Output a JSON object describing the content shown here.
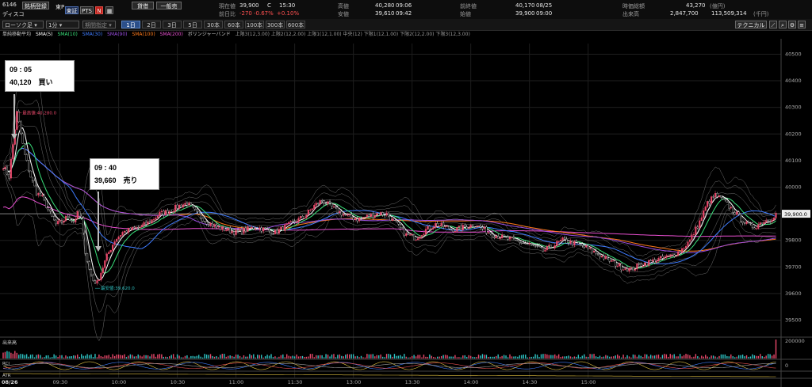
{
  "header": {
    "code": "6146",
    "name": "ディスコ",
    "btn_register": "銘柄登録",
    "tag_market": "東P",
    "btn_tosho": "東証",
    "btn_pts": "PTS",
    "btn_n": "N",
    "btn_buy": "貸借",
    "btn_general": "一般売",
    "current_label": "現在値",
    "current_value": "39,900",
    "current_flag": "C",
    "current_time": "15:30",
    "change_label": "前日比",
    "change_value": "-270",
    "change_pct": "-0.67%",
    "change_extra": "+0.10%",
    "high_label": "高値",
    "high_value": "40,280",
    "high_time": "09:06",
    "low_label": "安値",
    "low_value": "39,610",
    "low_time": "09:42",
    "prev_label": "前終値",
    "prev_value": "40,170",
    "prev_date": "08/25",
    "open_label": "始値",
    "open_value": "39,900",
    "open_time": "09:00",
    "mcap_label": "時価総額",
    "mcap_value": "43,270",
    "mcap_unit": "(億円)",
    "volume_label": "出来高",
    "volume_value": "2,847,700",
    "turnover_value": "113,509,314",
    "turnover_unit": "(千円)"
  },
  "toolbar": {
    "candle_select": "ローソク足",
    "interval_select": "1分",
    "period_select": "期間指定",
    "timeframes": [
      "1日",
      "2日",
      "3日",
      "5日",
      "30本",
      "60本",
      "100本",
      "300本",
      "600本"
    ],
    "active_timeframe": "1日",
    "technical_btn": "テクニカル"
  },
  "legend": {
    "sma_label": "単純移動平均",
    "sma5": "SMA(5)",
    "sma10": "SMA(10)",
    "sma30": "SMA(30)",
    "sma90": "SMA(90)",
    "sma100": "SMA(100)",
    "sma200": "SMA(200)",
    "bb_label": "ボリンジャーバンド",
    "bb_items": "上限3(12,3.00)  上限2(12,2.00)  上限1(12,1.00)  中央(12)  下限1(12,1.00)  下限2(12,2.00)  下限3(12,3.00)"
  },
  "callouts": {
    "buy_time": "09 : 05",
    "buy_text": "40,120　買い",
    "sell_time": "09 : 40",
    "sell_text": "39,660　売り"
  },
  "colors": {
    "sma5": "#ffffff",
    "sma10": "#39e07a",
    "sma30": "#3f7cff",
    "sma90": "#9a4de0",
    "sma100": "#ff7a1a",
    "sma200": "#e84fd0",
    "up": "#e8486a",
    "down": "#ffffff",
    "bb": "#8a8a8a"
  },
  "chart_data": {
    "type": "candlestick",
    "date": "08/26",
    "x_ticks": [
      "09:30",
      "10:00",
      "10:30",
      "11:00",
      "11:30",
      "13:00",
      "13:30",
      "14:00",
      "14:30",
      "15:00"
    ],
    "y_ticks": [
      40500,
      40400,
      40300,
      40200,
      40100,
      40000,
      39900,
      39800,
      39700,
      39600,
      39500
    ],
    "ylim": [
      39445,
      40540
    ],
    "current_price_label": "39,900.0",
    "high_marker": "最高値:40,280.0",
    "low_marker": "最安値:39,620.0",
    "price_path": [
      [
        0,
        40080
      ],
      [
        3,
        40040
      ],
      [
        5,
        40160
      ],
      [
        7,
        40280
      ],
      [
        9,
        40200
      ],
      [
        11,
        40120
      ],
      [
        14,
        40040
      ],
      [
        17,
        39980
      ],
      [
        20,
        39960
      ],
      [
        24,
        39900
      ],
      [
        27,
        39860
      ],
      [
        30,
        39870
      ],
      [
        33,
        39890
      ],
      [
        36,
        39870
      ],
      [
        38,
        39900
      ],
      [
        40,
        39880
      ],
      [
        42,
        39760
      ],
      [
        44,
        39690
      ],
      [
        46,
        39650
      ],
      [
        48,
        39640
      ],
      [
        50,
        39680
      ],
      [
        53,
        39740
      ],
      [
        57,
        39800
      ],
      [
        61,
        39830
      ],
      [
        65,
        39840
      ],
      [
        70,
        39850
      ],
      [
        75,
        39870
      ],
      [
        80,
        39900
      ],
      [
        85,
        39910
      ],
      [
        90,
        39930
      ],
      [
        94,
        39940
      ],
      [
        99,
        39900
      ],
      [
        104,
        39870
      ],
      [
        109,
        39850
      ],
      [
        114,
        39840
      ],
      [
        119,
        39830
      ],
      [
        124,
        39840
      ],
      [
        129,
        39850
      ],
      [
        134,
        39840
      ],
      [
        139,
        39830
      ],
      [
        144,
        39850
      ],
      [
        149,
        39870
      ],
      [
        154,
        39890
      ],
      [
        159,
        39930
      ],
      [
        163,
        39950
      ],
      [
        167,
        39930
      ],
      [
        171,
        39910
      ],
      [
        176,
        39890
      ],
      [
        181,
        39880
      ],
      [
        186,
        39890
      ],
      [
        191,
        39900
      ],
      [
        196,
        39900
      ],
      [
        201,
        39860
      ],
      [
        206,
        39820
      ],
      [
        211,
        39810
      ],
      [
        216,
        39840
      ],
      [
        221,
        39860
      ],
      [
        226,
        39850
      ],
      [
        231,
        39840
      ],
      [
        236,
        39850
      ],
      [
        241,
        39860
      ],
      [
        246,
        39840
      ],
      [
        251,
        39820
      ],
      [
        256,
        39810
      ],
      [
        261,
        39800
      ],
      [
        266,
        39790
      ],
      [
        271,
        39780
      ],
      [
        276,
        39760
      ],
      [
        281,
        39780
      ],
      [
        286,
        39800
      ],
      [
        291,
        39790
      ],
      [
        296,
        39780
      ],
      [
        301,
        39760
      ],
      [
        306,
        39740
      ],
      [
        311,
        39720
      ],
      [
        316,
        39700
      ],
      [
        321,
        39690
      ],
      [
        326,
        39710
      ],
      [
        331,
        39720
      ],
      [
        336,
        39730
      ],
      [
        341,
        39740
      ],
      [
        346,
        39760
      ],
      [
        351,
        39800
      ],
      [
        356,
        39870
      ],
      [
        360,
        39940
      ],
      [
        364,
        39970
      ],
      [
        368,
        39950
      ],
      [
        372,
        39920
      ],
      [
        376,
        39890
      ],
      [
        380,
        39860
      ],
      [
        384,
        39850
      ],
      [
        388,
        39870
      ],
      [
        392,
        39880
      ],
      [
        395,
        39900
      ]
    ],
    "sma_levels": [
      {
        "name": "SMA(5)",
        "start": 40080,
        "end": 39880
      },
      {
        "name": "SMA(10)",
        "start": 40060,
        "end": 39870
      },
      {
        "name": "SMA(30)",
        "start": 40060,
        "end": 39870
      },
      {
        "name": "SMA(90)",
        "start": 40020,
        "end": 39830
      },
      {
        "name": "SMA(100)",
        "start": 39920,
        "end": 39780
      },
      {
        "name": "SMA(200)",
        "start": 39780,
        "end": 39820
      }
    ],
    "volume_max": 200000,
    "rci_ticks": [
      0
    ]
  }
}
